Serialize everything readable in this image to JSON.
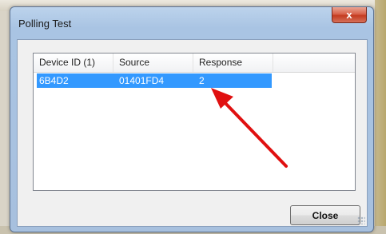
{
  "window": {
    "title": "Polling Test",
    "close_glyph": "x"
  },
  "list": {
    "columns": [
      "Device ID (1)",
      "Source",
      "Response",
      ""
    ],
    "rows": [
      {
        "device_id": "6B4D2",
        "source": "01401FD4",
        "response": "2",
        "selected": true
      }
    ]
  },
  "buttons": {
    "close_label": "Close"
  },
  "colors": {
    "selection": "#3399ff",
    "annotation_arrow": "#e01010"
  }
}
